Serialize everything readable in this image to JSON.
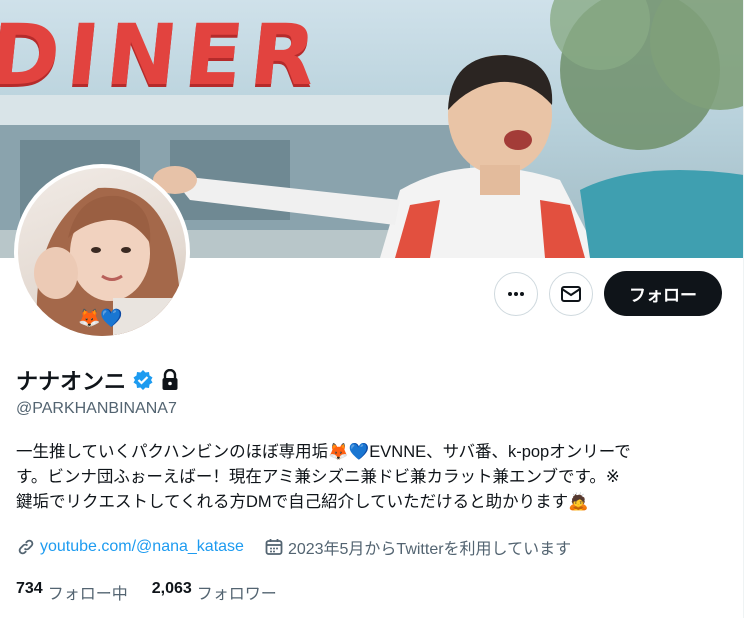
{
  "banner": {
    "sign_text": "DINER"
  },
  "profile": {
    "display_name": "ナナオンニ",
    "handle": "@PARKHANBINANA7",
    "avatar_emoji": "🦊💙",
    "bio_lines": [
      "一生推していくパクハンビンのほぼ専用垢🦊💙EVNNE、サバ番、k-popオンリーで",
      "す。ビンナ団ふぉーえばー！現在アミ兼シズニ兼ドビ兼カラット兼エンブです。※",
      "鍵垢でリクエストしてくれる方DMで自己紹介していただけると助かります🙇"
    ],
    "link": "youtube.com/@nana_katase",
    "joined": "2023年5月からTwitterを利用しています",
    "following_count": "734",
    "following_label": "フォロー中",
    "followers_count": "2,063",
    "followers_label": "フォロワー"
  },
  "actions": {
    "follow_label": "フォロー"
  },
  "colors": {
    "accent": "#1d9bf0",
    "text": "#0f1419",
    "muted": "#536471",
    "button_dark": "#0f1419"
  },
  "icons": [
    "more-icon",
    "mail-icon",
    "verified-badge-icon",
    "lock-icon",
    "link-icon",
    "calendar-icon"
  ]
}
